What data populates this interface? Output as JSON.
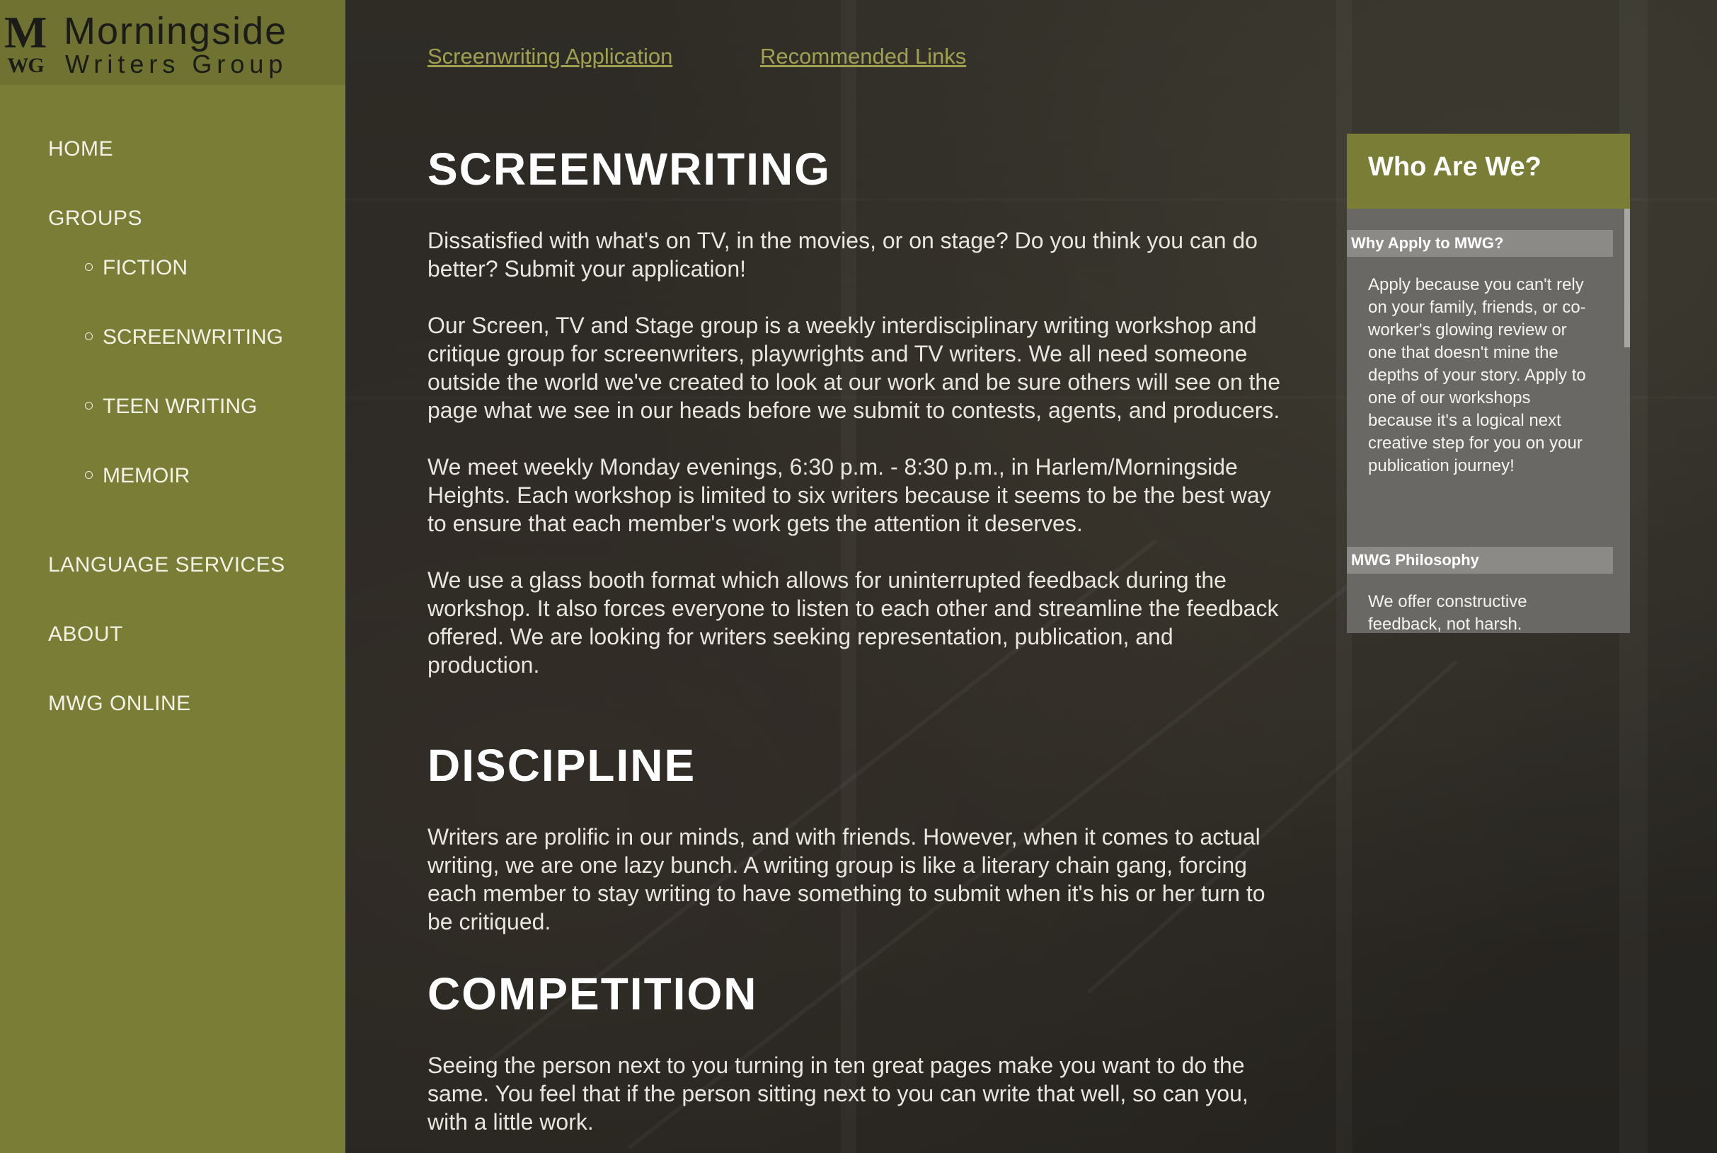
{
  "logo": {
    "mark_letter": "M",
    "mark_initials": "WG",
    "line1": "Morningside",
    "line2": "Writers Group"
  },
  "nav": {
    "items": [
      {
        "label": "HOME"
      },
      {
        "label": "GROUPS"
      },
      {
        "label": "LANGUAGE SERVICES"
      },
      {
        "label": "ABOUT"
      },
      {
        "label": "MWG ONLINE"
      }
    ],
    "sub_items": [
      {
        "label": "FICTION"
      },
      {
        "label": "SCREENWRITING"
      },
      {
        "label": "TEEN WRITING"
      },
      {
        "label": "MEMOIR"
      }
    ]
  },
  "top_links": [
    {
      "label": "Screenwriting Application"
    },
    {
      "label": "Recommended Links"
    }
  ],
  "main": {
    "heading1": "SCREENWRITING",
    "para1": "Dissatisfied with what's on TV, in the movies, or on stage? Do you think you can do better? Submit your application!",
    "para2": "Our Screen, TV and Stage group is a weekly interdisciplinary writing workshop and critique group for screenwriters, playwrights and TV writers. We all need someone outside the world we've created to look at our work and be sure others will see on the page what we see in our heads before we submit to contests, agents, and producers.",
    "para3": "We meet weekly Monday evenings, 6:30 p.m. - 8:30 p.m., in Harlem/Morningside Heights. Each workshop is limited to six writers because it seems to be the best way to ensure that each member's work gets the attention it deserves.",
    "para4": "We use a glass booth format which allows for uninterrupted feedback during the workshop. It also forces everyone to listen to each other and streamline the feedback offered. We are looking for writers seeking representation, publication, and production.",
    "heading2": "DISCIPLINE",
    "para5": "Writers are prolific in our minds, and with friends. However, when it comes to actual writing, we are one lazy bunch. A writing group is like a literary chain gang, forcing each member to stay writing to have something to submit when it's his or her turn to be critiqued.",
    "heading3": "COMPETITION",
    "para6": "Seeing the person next to you turning in ten great pages make you want to do the same. You feel that if the person sitting next to you can write that well, so can you, with a little work."
  },
  "widget": {
    "title": "Who Are We?",
    "sections": [
      {
        "heading": "Why Apply to MWG?",
        "text": "Apply because you can't rely on your family, friends, or co-worker's glowing review or one that doesn't mine the depths of your story. Apply to one of our workshops because it's a logical next creative step for you on your publication journey!"
      },
      {
        "heading": "MWG Philosophy",
        "text": "We offer constructive feedback, not harsh."
      }
    ]
  },
  "colors": {
    "sidebar": "#7a7d35",
    "link": "#9fa14f",
    "widget_body": "#6a6864",
    "accordion_head": "#8c8a86"
  }
}
